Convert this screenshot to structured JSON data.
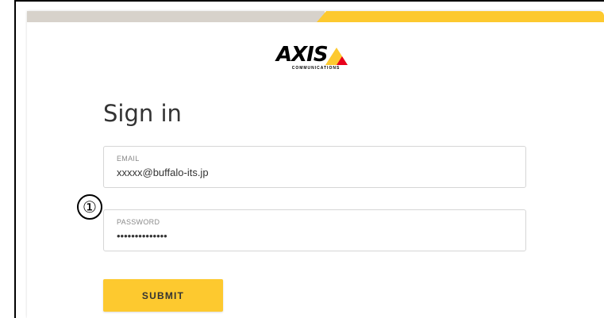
{
  "brand": {
    "logo_text": "AXIS",
    "logo_sub": "COMMUNICATIONS",
    "accent": "#fdc92f"
  },
  "form": {
    "title": "Sign in",
    "email": {
      "label": "EMAIL",
      "value": "xxxxx@buffalo-its.jp"
    },
    "password": {
      "label": "PASSWORD",
      "value": "••••••••••••••"
    },
    "submit_label": "SUBMIT"
  },
  "annotation": {
    "marker": "①"
  }
}
